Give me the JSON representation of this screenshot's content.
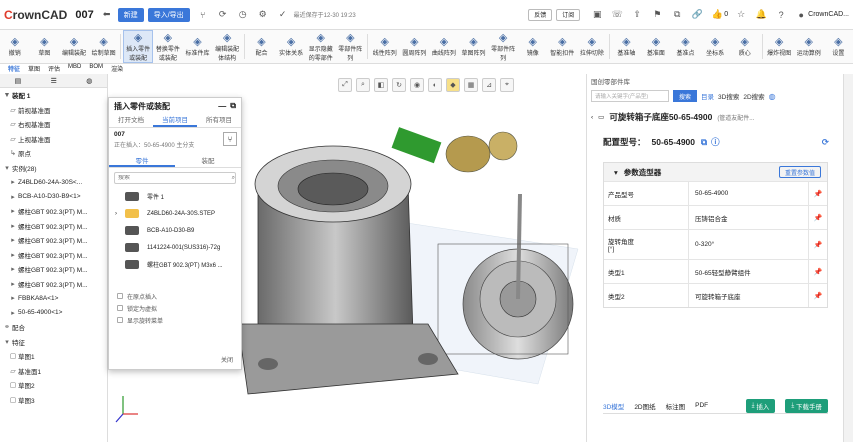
{
  "title": {
    "logo_prefix": "C",
    "logo": "rownCAD",
    "doc_number": "007",
    "new_btn": "新建",
    "import_btn": "导入/导出",
    "saved_text": "最近保存于12-30 19:23",
    "review_btn": "反馈",
    "free_btn": "订阅",
    "like_count": "0",
    "username": "CrownCAD..."
  },
  "ribbon": {
    "tools": [
      {
        "label": "撤销",
        "icon": "undo"
      },
      {
        "label": "草图",
        "icon": "sketch"
      },
      {
        "label": "编辑装配",
        "icon": "edit"
      },
      {
        "label": "绘制草图",
        "icon": "draw"
      },
      {
        "label": "插入零件或装配",
        "icon": "insert"
      },
      {
        "label": "替换零件或装配",
        "icon": "replace"
      },
      {
        "label": "标准件库",
        "icon": "lib"
      },
      {
        "label": "编辑装配体结构",
        "icon": "struct"
      },
      {
        "label": "配合",
        "icon": "mate"
      },
      {
        "label": "实体关系",
        "icon": "rel"
      },
      {
        "label": "显示隐藏的零部件",
        "icon": "show"
      },
      {
        "label": "零部件阵列",
        "icon": "pattern"
      },
      {
        "label": "线性阵列",
        "icon": "linear"
      },
      {
        "label": "圆周阵列",
        "icon": "circular"
      },
      {
        "label": "曲线阵列",
        "icon": "curve"
      },
      {
        "label": "草图阵列",
        "icon": "skarray"
      },
      {
        "label": "零部件阵列",
        "icon": "arr"
      },
      {
        "label": "镜像",
        "icon": "mirror"
      },
      {
        "label": "智能扣件",
        "icon": "fastener"
      },
      {
        "label": "拉伸切除",
        "icon": "cut"
      },
      {
        "label": "基准轴",
        "icon": "axis"
      },
      {
        "label": "基准面",
        "icon": "plane"
      },
      {
        "label": "基准点",
        "icon": "point"
      },
      {
        "label": "坐标系",
        "icon": "coord"
      },
      {
        "label": "质心",
        "icon": "mass"
      },
      {
        "label": "爆炸视图",
        "icon": "explode"
      },
      {
        "label": "运动算例",
        "icon": "motion"
      },
      {
        "label": "设置",
        "icon": "settings"
      }
    ]
  },
  "left_tabs": [
    "特征",
    "草图",
    "评估",
    "MBD",
    "BOM",
    "渲染"
  ],
  "tree": {
    "rows": [
      {
        "text": "装配 1",
        "icon": "assembly-icon"
      },
      {
        "text": "前视基准面",
        "icon": "plane-icon"
      },
      {
        "text": "右视基准面",
        "icon": "plane-icon"
      },
      {
        "text": "上视基准面",
        "icon": "plane-icon"
      },
      {
        "text": "原点",
        "icon": "origin-icon"
      },
      {
        "text": "实例(28)",
        "icon": "folder-icon"
      },
      {
        "text": "Z4BLD60-24A-30S<...",
        "icon": "part-icon"
      },
      {
        "text": "BCB-A10-D30-B9<1>",
        "icon": "part-icon"
      },
      {
        "text": "螺柱GBT 902.3(PT) M...",
        "icon": "part-icon"
      },
      {
        "text": "螺柱GBT 902.3(PT) M...",
        "icon": "part-icon"
      },
      {
        "text": "螺柱GBT 902.3(PT) M...",
        "icon": "part-icon"
      },
      {
        "text": "螺柱GBT 902.3(PT) M...",
        "icon": "part-icon"
      },
      {
        "text": "螺柱GBT 902.3(PT) M...",
        "icon": "part-icon"
      },
      {
        "text": "螺柱GBT 902.3(PT) M...",
        "icon": "part-icon"
      },
      {
        "text": "FBBKA8A<1>",
        "icon": "part-icon"
      },
      {
        "text": "50-65-4900<1>",
        "icon": "part-icon"
      },
      {
        "text": "配合",
        "icon": "mate-icon"
      },
      {
        "text": "特征",
        "icon": "feature-icon"
      },
      {
        "text": "草图1",
        "icon": "sketch-icon"
      },
      {
        "text": "基准面1",
        "icon": "plane-icon"
      },
      {
        "text": "草图2",
        "icon": "sketch-icon"
      },
      {
        "text": "草图3",
        "icon": "sketch-icon"
      }
    ]
  },
  "dialog": {
    "title": "插入零件或装配",
    "tabs": [
      "打开文档",
      "当前项目",
      "所有项目"
    ],
    "project_name": "007",
    "project_meta": "正在插入：50-65-4900 主分支",
    "subtabs": [
      "零件",
      "装配"
    ],
    "search_placeholder": "搜索",
    "parts": [
      "零件 1",
      "Z4BLD60-24A-30S.STEP",
      "BCB-A10-D30-B9",
      "1141224-001(SUS316)-72g",
      "螺柱GBT 902.3(PT) M3x6 ..."
    ],
    "options": [
      "在原点插入",
      "锁定为虚拟",
      "显示旋转菜单"
    ],
    "close": "关闭"
  },
  "right": {
    "header": "国创零部件库",
    "search_placeholder": "请输入关键字(产品型)",
    "search_btn": "搜索",
    "nav": [
      "目录",
      "3D搜索",
      "2D搜索"
    ],
    "product_title": "可旋转箱子底座50-65-4900",
    "product_extra": "(管道友配件...",
    "model_label": "配置型号：",
    "model_value": "50-65-4900",
    "params_title": "参数造型器",
    "reset_btn": "重置参数值",
    "params": [
      {
        "key": "产品型号",
        "value": "50-65-4900"
      },
      {
        "key": "材质",
        "value": "压铸铝合金"
      },
      {
        "key": "旋转角度\n[°]",
        "value": "0-320°"
      },
      {
        "key": "类型1",
        "value": "50-65轻型静臂组件"
      },
      {
        "key": "类型2",
        "value": "可旋转箱子底座"
      }
    ],
    "bottom_tabs": [
      "3D模型",
      "2D图纸",
      "标注图",
      "PDF"
    ],
    "insert_btn": "插入",
    "download_btn": "下载手册"
  }
}
